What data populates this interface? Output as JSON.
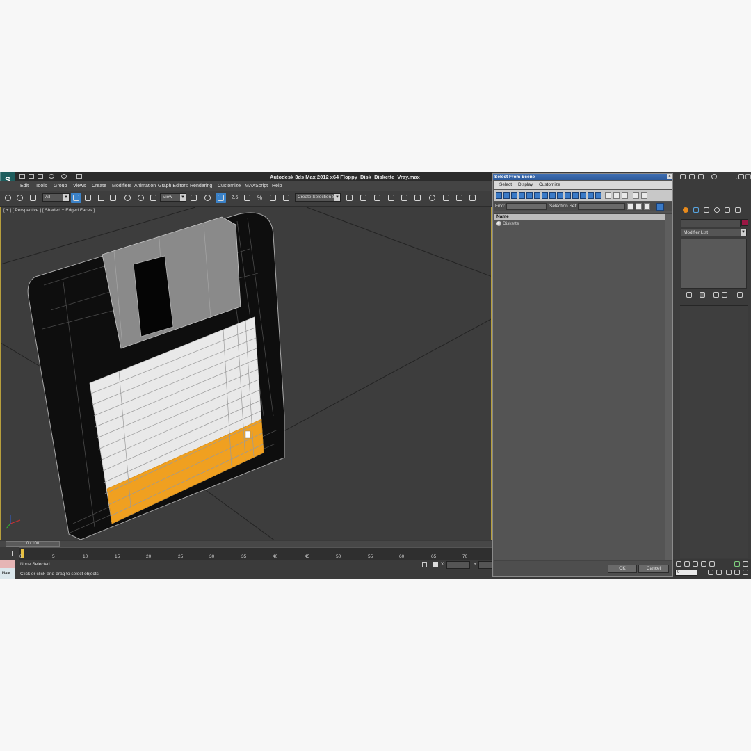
{
  "window": {
    "logo": "S",
    "title": "Autodesk 3ds Max  2012 x64     Floppy_Disk_Diskette_Vray.max"
  },
  "menubar": [
    "Edit",
    "Tools",
    "Group",
    "Views",
    "Create",
    "Modifiers",
    "Animation",
    "Graph Editors",
    "Rendering",
    "Customize",
    "MAXScript",
    "Help"
  ],
  "toolbar": {
    "filter_value": "All",
    "refcoord_value": "View",
    "numeric_snap": "2.5",
    "percent_snap": "%",
    "selection_set_placeholder": "Create Selection Se"
  },
  "viewport": {
    "label": "[ + ] [ Perspective ] [ Shaded + Edged Faces ]"
  },
  "timeline": {
    "frame_readout": "0 / 100",
    "ticks": [
      "0",
      "5",
      "10",
      "15",
      "20",
      "25",
      "30",
      "35",
      "40",
      "45",
      "50",
      "55",
      "60",
      "65",
      "70"
    ]
  },
  "status": {
    "maxscript_label": "Max",
    "selection": "None Selected",
    "prompt": "Click or click-and-drag to select objects",
    "x_label": "X:",
    "y_label": "Y:"
  },
  "dialog": {
    "title": "Select From Scene",
    "menu": [
      "Select",
      "Display",
      "Customize"
    ],
    "find_label": "Find:",
    "selection_set_label": "Selection Set:",
    "column_name": "Name",
    "rows": [
      "Diskette"
    ],
    "ok": "OK",
    "cancel": "Cancel"
  },
  "command_panel": {
    "modifier_list": "Modifier List",
    "object_color": "#9b1744",
    "current_frame": "0"
  },
  "colors": {
    "label_orange": "#f0a020",
    "disk_body": "#111111",
    "shutter": "#8a8a8a"
  }
}
